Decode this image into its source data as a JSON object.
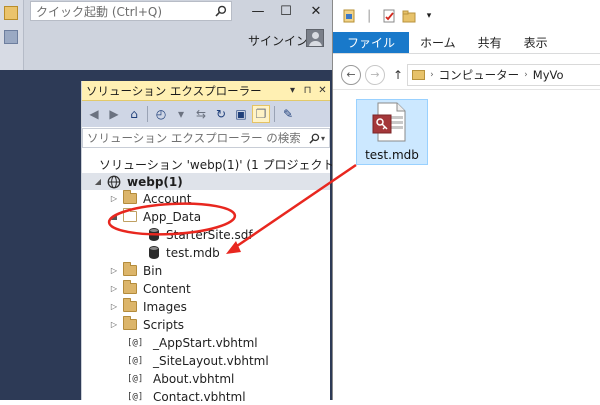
{
  "vs": {
    "quick_launch_placeholder": "クイック起動 (Ctrl+Q)",
    "minimize_glyph": "—",
    "maximize_glyph": "☐",
    "close_glyph": "✕",
    "signin_label": "サインイン"
  },
  "solution_explorer": {
    "title": "ソリューション エクスプローラー",
    "title_buttons": [
      "▾",
      "⊓",
      "✕"
    ],
    "search_placeholder": "ソリューション エクスプローラー の検索 (Ctrl+",
    "solution_label": "ソリューション 'webp(1)' (1 プロジェクト)",
    "project_label": "webp(1)",
    "items": [
      {
        "label": "Account",
        "kind": "folder"
      },
      {
        "label": "App_Data",
        "kind": "folder-open"
      },
      {
        "label": "StarterSite.sdf",
        "kind": "database"
      },
      {
        "label": "test.mdb",
        "kind": "database"
      },
      {
        "label": "Bin",
        "kind": "folder"
      },
      {
        "label": "Content",
        "kind": "folder"
      },
      {
        "label": "Images",
        "kind": "folder"
      },
      {
        "label": "Scripts",
        "kind": "folder"
      },
      {
        "label": "_AppStart.vbhtml",
        "kind": "vbhtml"
      },
      {
        "label": "_SiteLayout.vbhtml",
        "kind": "vbhtml"
      },
      {
        "label": "About.vbhtml",
        "kind": "vbhtml"
      },
      {
        "label": "Contact.vbhtml",
        "kind": "vbhtml"
      }
    ],
    "vbhtml_glyph": "[@]"
  },
  "explorer": {
    "ribbon_tabs": [
      "ファイル",
      "ホーム",
      "共有",
      "表示"
    ],
    "address": {
      "segments": [
        "コンピューター",
        "MyVo"
      ]
    },
    "file": {
      "name": "test.mdb"
    }
  },
  "colors": {
    "annotation_red": "#e8271f",
    "selection_blue": "#cce8ff",
    "ribbon_file_blue": "#1979ca"
  }
}
